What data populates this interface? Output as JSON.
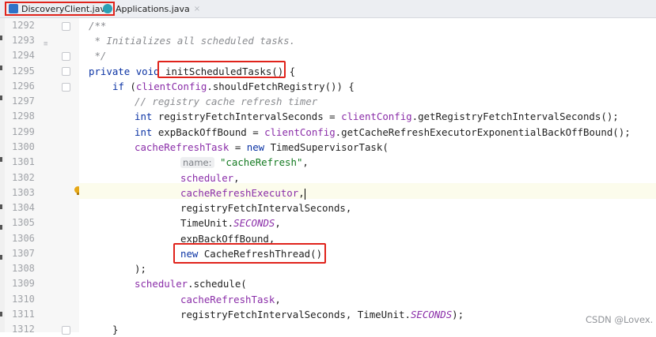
{
  "tabs": [
    {
      "label": "DiscoveryClient.java",
      "active": true
    },
    {
      "label": "Applications.java",
      "active": false,
      "close": "×"
    }
  ],
  "line_numbers": [
    "1292",
    "1293",
    "1294",
    "1295",
    "1296",
    "1297",
    "1298",
    "1299",
    "1300",
    "1301",
    "1302",
    "1303",
    "1304",
    "1305",
    "1306",
    "1307",
    "1308",
    "1309",
    "1310",
    "1311",
    "1312"
  ],
  "code": {
    "l1292": "/**",
    "l1293": " * Initializes all scheduled tasks.",
    "l1294": " */",
    "l1295_kw1": "private",
    "l1295_kw2": "void",
    "l1295_method": "initScheduledTasks()",
    "l1295_tail": " {",
    "l1296_kw": "if",
    "l1296_a": " (",
    "l1296_field": "clientConfig",
    "l1296_b": ".shouldFetchRegistry()) {",
    "l1297": "// registry cache refresh timer",
    "l1298_kw": "int",
    "l1298_a": " registryFetchIntervalSeconds = ",
    "l1298_field": "clientConfig",
    "l1298_b": ".getRegistryFetchIntervalSeconds();",
    "l1299_kw": "int",
    "l1299_a": " expBackOffBound = ",
    "l1299_field": "clientConfig",
    "l1299_b": ".getCacheRefreshExecutorExponentialBackOffBound();",
    "l1300_field": "cacheRefreshTask",
    "l1300_a": " = ",
    "l1300_kw": "new",
    "l1300_b": " TimedSupervisorTask(",
    "l1301_hint": "name:",
    "l1301_str": "\"cacheRefresh\"",
    "l1301_tail": ",",
    "l1302_field": "scheduler",
    "l1302_tail": ",",
    "l1303_field": "cacheRefreshExecutor",
    "l1303_tail": ",",
    "l1304": "registryFetchIntervalSeconds,",
    "l1305_a": "TimeUnit.",
    "l1305_it": "SECONDS",
    "l1305_tail": ",",
    "l1306": "expBackOffBound,",
    "l1307_kw": "new",
    "l1307_a": " CacheRefreshThread()",
    "l1308": ");",
    "l1309_field": "scheduler",
    "l1309_a": ".schedule(",
    "l1310_field": "cacheRefreshTask",
    "l1310_tail": ",",
    "l1311_a": "registryFetchIntervalSeconds, TimeUnit.",
    "l1311_it": "SECONDS",
    "l1311_tail": ");",
    "l1312": "}"
  },
  "watermark": "CSDN @Lovex.",
  "colors": {
    "keyword": "#0b33a4",
    "field": "#8a2da8",
    "string": "#147a21",
    "comment": "#8a8c90",
    "annotation_box": "#e0231b"
  }
}
